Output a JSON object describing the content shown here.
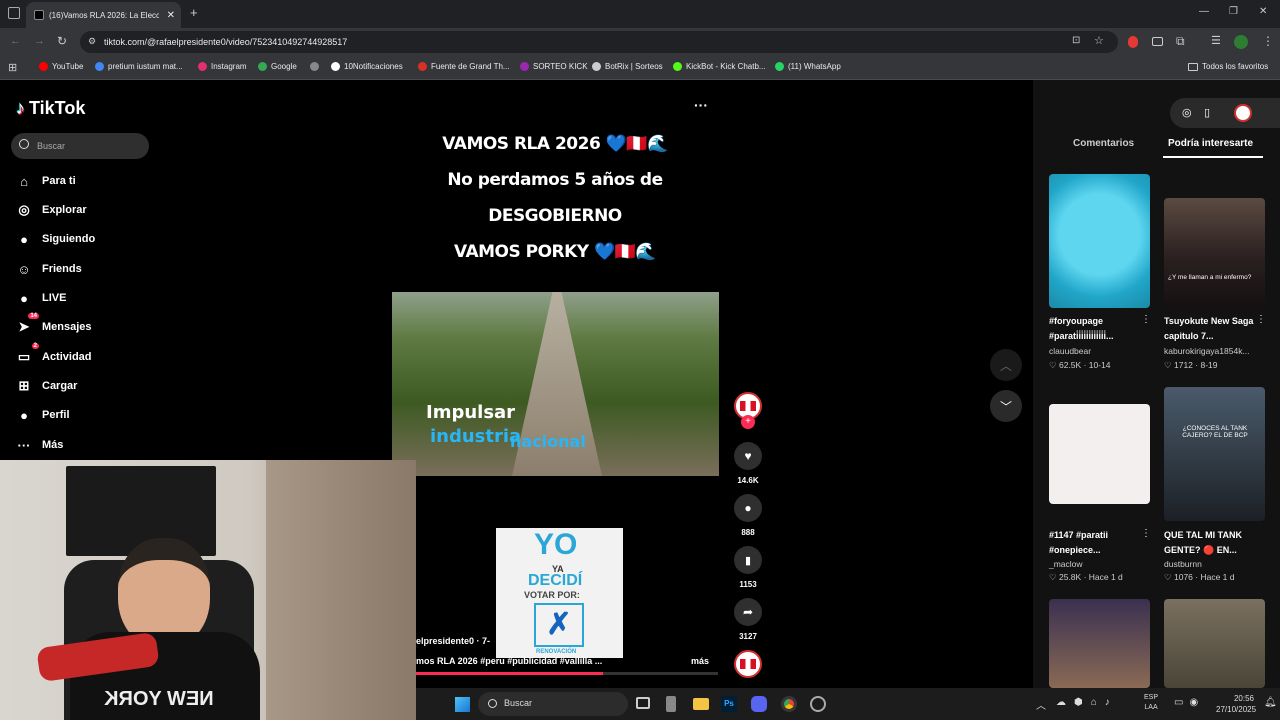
{
  "browser": {
    "tab_title": "(16)Vamos RLA 2026: La Elecci",
    "tab_close": "✕",
    "new_tab": "+",
    "url": "tiktok.com/@rafaelpresidente0/video/7523410492744928517",
    "bookmarks": [
      "YouTube",
      "pretium iustum mat...",
      "Instagram",
      "Google",
      "",
      "10Notificaciones",
      "Fuente de Grand Th...",
      "SORTEO KICK",
      "BotRix | Sorteos",
      "KickBot - Kick Chatb...",
      "(11) WhatsApp"
    ],
    "all_favorites": "Todos los favoritos",
    "bookmark_colors": [
      "#ff0000",
      "#4285f4",
      "#e1306c",
      "#34a853",
      "#888888",
      "#ffffff",
      "#d93025",
      "#9c27b0",
      "#cccccc",
      "#53fc18",
      "#25d366"
    ]
  },
  "tiktok": {
    "logo": "TikTok",
    "search_placeholder": "Buscar",
    "nav": [
      {
        "label": "Para ti",
        "icon": "home-icon",
        "glyph": "⌂"
      },
      {
        "label": "Explorar",
        "icon": "compass-icon",
        "glyph": "◎"
      },
      {
        "label": "Siguiendo",
        "icon": "following-avatar-icon",
        "glyph": "●"
      },
      {
        "label": "Friends",
        "icon": "friends-icon",
        "glyph": "☺"
      },
      {
        "label": "LIVE",
        "icon": "live-icon",
        "glyph": "●"
      },
      {
        "label": "Mensajes",
        "icon": "messages-icon",
        "glyph": "➤",
        "badge": "14"
      },
      {
        "label": "Actividad",
        "icon": "activity-icon",
        "glyph": "▭",
        "badge": "2"
      },
      {
        "label": "Cargar",
        "icon": "upload-icon",
        "glyph": "⊞"
      },
      {
        "label": "Perfil",
        "icon": "profile-avatar-icon",
        "glyph": "●"
      },
      {
        "label": "Más",
        "icon": "more-icon",
        "glyph": "···"
      }
    ],
    "more_dots": "···",
    "video_text": {
      "line1": "VAMOS RLA 2026 💙🇵🇪🌊",
      "line2": "No perdamos 5 años de",
      "line3": "DESGOBIERNO",
      "line4": "VAMOS PORKY 💙🇵🇪🌊"
    },
    "clip_text1": "Impulsar",
    "clip_text2": "industria",
    "clip_text3": "nacional",
    "poster": {
      "yo": "YO",
      "ya": "YA",
      "decidi": "DECIDÍ",
      "votar": "VOTAR POR:",
      "party": "RENOVACIÓN"
    },
    "author_line": "elpresidente0 · 7-",
    "caption": "mos RLA 2026 #peru #publicidad #vallilla ...",
    "more_label": "más",
    "actions": {
      "likes": "14.6K",
      "comments": "888",
      "saves": "1153",
      "shares": "3127"
    },
    "tabs": {
      "comments": "Comentarios",
      "related": "Podría interesarte"
    },
    "cards": [
      {
        "title": "#foryoupage #parati̇i̇i̇i̇i̇i̇i̇i̇i̇i̇i̇i̇...",
        "user": "clauudbear",
        "likes": "62.5K",
        "date": "10-14",
        "thumb_text": ""
      },
      {
        "title": "Tsuyokute New Saga capitulo 7...",
        "user": "kaburokirigaya1854k...",
        "likes": "1712",
        "date": "8-19",
        "thumb_text": "¿Y me llaman a mi enfermo?"
      },
      {
        "title": "#1147 #paratii #onepiece...",
        "user": "_maclow",
        "likes": "25.8K",
        "date": "Hace 1 d",
        "thumb_text": ""
      },
      {
        "title": "QUE TAL MI TANK GENTE? 🔴 EN...",
        "user": "dustburnn",
        "likes": "1076",
        "date": "Hace 1 d",
        "thumb_text": "¿CONOCES AL TANK CAJERO? EL DE BCP"
      }
    ]
  },
  "taskbar": {
    "search": "Buscar",
    "lang1": "ESP",
    "lang2": "LAA",
    "time": "20:56",
    "date": "27/10/2025"
  },
  "webcam": {
    "shirt_text": "NEW YORK"
  }
}
